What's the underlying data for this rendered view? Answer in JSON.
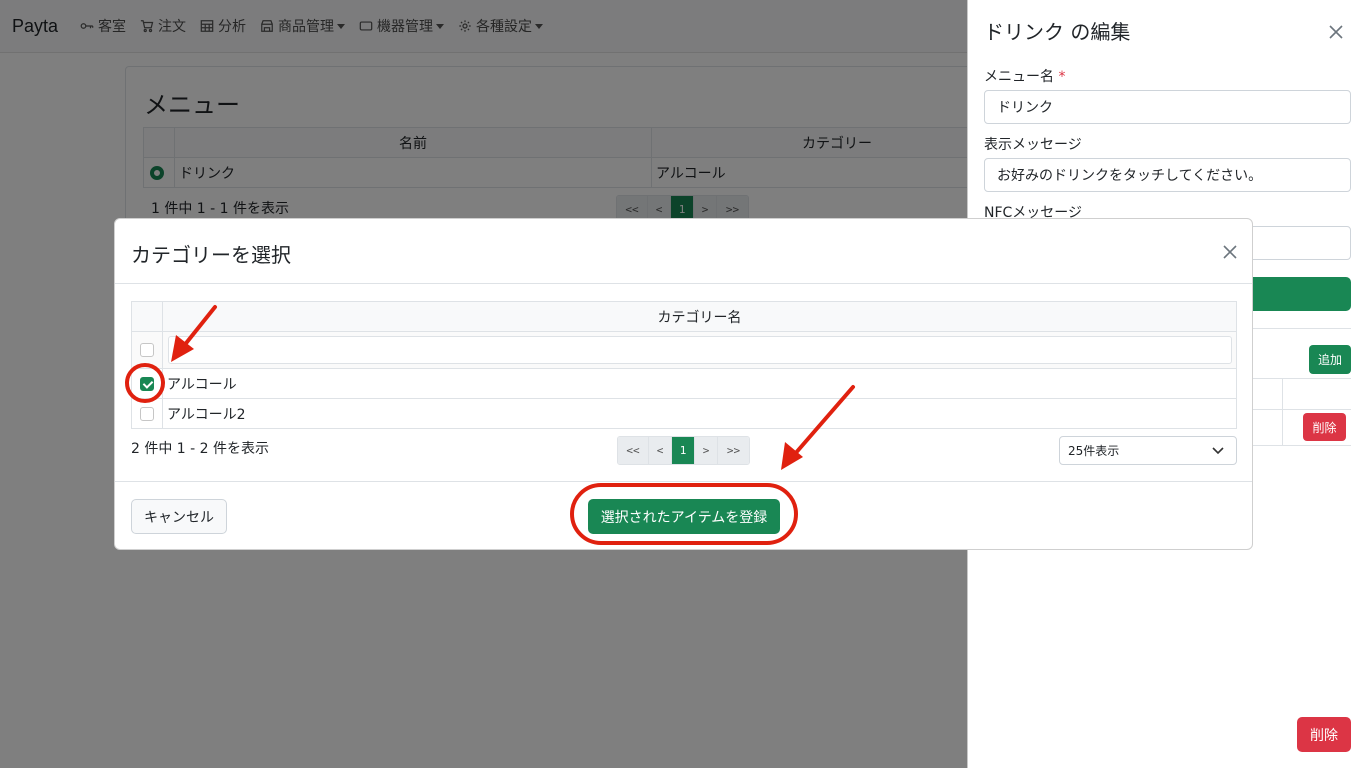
{
  "navbar": {
    "brand": "Payta",
    "items": [
      {
        "label": "客室",
        "icon": "key-icon",
        "dropdown": false
      },
      {
        "label": "注文",
        "icon": "cart-icon",
        "dropdown": false
      },
      {
        "label": "分析",
        "icon": "table-icon",
        "dropdown": false
      },
      {
        "label": "商品管理",
        "icon": "shop-icon",
        "dropdown": true
      },
      {
        "label": "機器管理",
        "icon": "device-icon",
        "dropdown": true
      },
      {
        "label": "各種設定",
        "icon": "gear-icon",
        "dropdown": true
      }
    ]
  },
  "menu_card": {
    "title": "メニュー",
    "headers": [
      "名前",
      "カテゴリー"
    ],
    "rows": [
      {
        "name": "ドリンク",
        "category": "アルコール"
      }
    ],
    "count_text": "1 件中 1 - 1 件を表示",
    "pager": [
      "<<",
      "<",
      "1",
      ">",
      ">>"
    ]
  },
  "editor": {
    "title": "ドリンク の編集",
    "menu_name_label": "メニュー名",
    "required_mark": "*",
    "menu_name_value": "ドリンク",
    "display_message_label": "表示メッセージ",
    "display_message_value": "お好みのドリンクをタッチしてください。",
    "nfc_message_label": "NFCメッセージ",
    "add_label": "追加",
    "row_delete_label": "削除",
    "delete_label": "削除"
  },
  "modal": {
    "title": "カテゴリーを選択",
    "column_header": "カテゴリー名",
    "rows": [
      {
        "name": "アルコール",
        "checked": true
      },
      {
        "name": "アルコール2",
        "checked": false
      }
    ],
    "count_text": "2 件中 1 - 2 件を表示",
    "pager": [
      "<<",
      "<",
      "1",
      ">",
      ">>"
    ],
    "per_page": "25件表示",
    "cancel_label": "キャンセル",
    "submit_label": "選択されたアイテムを登録"
  },
  "colors": {
    "primary_green": "#198754",
    "danger_red": "#dc3545",
    "annotation_red": "#e0210f"
  }
}
